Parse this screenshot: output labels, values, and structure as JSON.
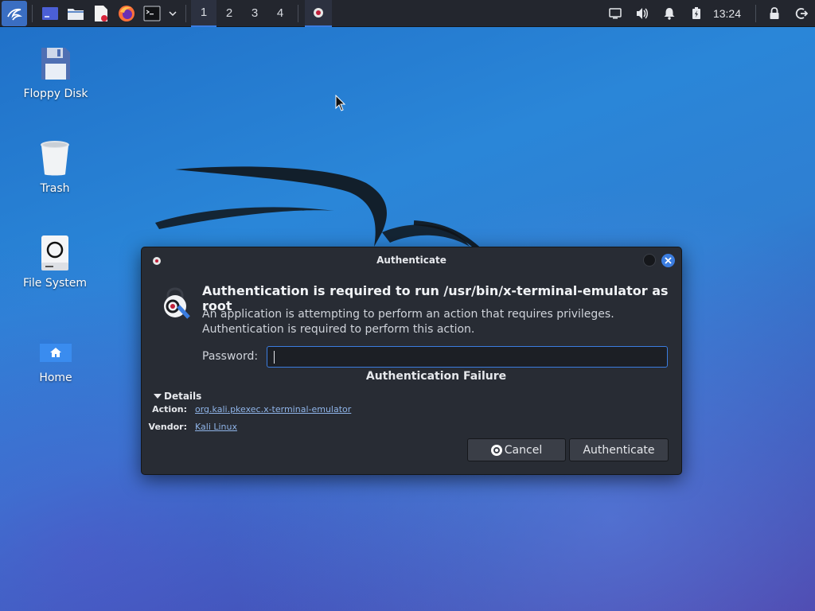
{
  "panel": {
    "workspaces": [
      "1",
      "2",
      "3",
      "4"
    ],
    "active_workspace_index": 0,
    "clock": "13:24",
    "launchers": [
      "desktop-icon",
      "file-manager-icon",
      "text-editor-icon",
      "firefox-icon",
      "terminal-icon",
      "chevron-down-icon"
    ],
    "tray": [
      "display-icon",
      "volume-icon",
      "bell-icon",
      "battery-icon",
      "lock-icon",
      "logout-icon"
    ]
  },
  "desktop": {
    "icons": [
      {
        "label": "Floppy Disk",
        "icon": "floppy-disk-icon"
      },
      {
        "label": "Trash",
        "icon": "trash-icon"
      },
      {
        "label": "File System",
        "icon": "file-system-icon"
      },
      {
        "label": "Home",
        "icon": "home-folder-icon"
      }
    ]
  },
  "dialog": {
    "title": "Authenticate",
    "heading": "Authentication is required to run /usr/bin/x-terminal-emulator as root",
    "description": "An application is attempting to perform an action that requires privileges. Authentication is required to perform this action.",
    "password_label": "Password:",
    "password_value": "",
    "failure_message": "Authentication Failure",
    "details_label": "Details",
    "details": {
      "action_key": "Action:",
      "action_value": "org.kali.pkexec.x-terminal-emulator",
      "vendor_key": "Vendor:",
      "vendor_value": "Kali Linux"
    },
    "cancel_label": "Cancel",
    "authenticate_label": "Authenticate"
  },
  "colors": {
    "accent": "#3b7de0",
    "panel_bg": "#23262e",
    "dialog_bg": "#282c34",
    "link": "#8fb4e8"
  }
}
